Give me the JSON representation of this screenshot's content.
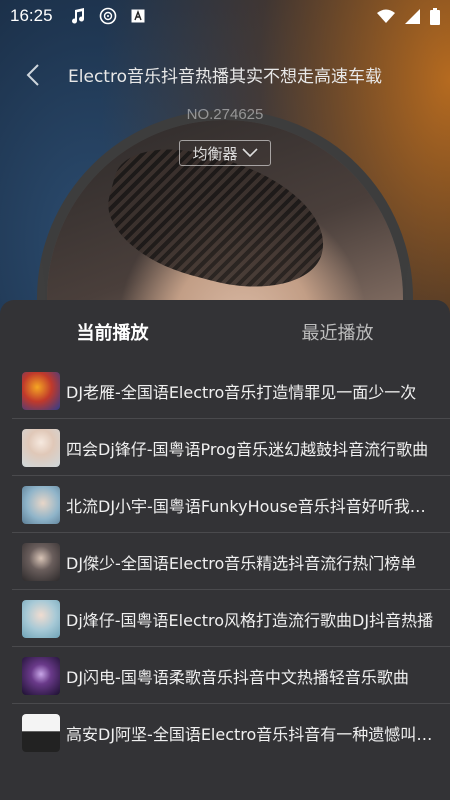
{
  "status_bar": {
    "time": "16:25",
    "left_icons": [
      "music-note-icon",
      "disc-icon",
      "font-a-icon"
    ],
    "right_icons": [
      "wifi-icon",
      "cellular-signal-icon",
      "battery-icon"
    ]
  },
  "player": {
    "title": "Electro音乐抖音热播其实不想走高速车载",
    "number": "NO.274625",
    "eq_label": "均衡器",
    "eq_icon": "chevron-down-icon",
    "back_icon": "back-arrow-icon"
  },
  "sheet": {
    "tabs": [
      {
        "label": "当前播放",
        "active": true
      },
      {
        "label": "最近播放",
        "active": false
      }
    ],
    "items": [
      {
        "title": "DJ老雁-全国语Electro音乐打造情罪见一面少一次",
        "thumb_color": "#c0392b"
      },
      {
        "title": "四会Dj锋仔-国粤语Prog音乐迷幻越鼓抖音流行歌曲",
        "thumb_color": "#e8d8cc"
      },
      {
        "title": "北流DJ小宇-国粤语FunkyHouse音乐抖音好听我的歌曲",
        "thumb_color": "#8fb4c9"
      },
      {
        "title": "DJ傑少-全国语Electro音乐精选抖音流行热门榜单",
        "thumb_color": "#4a4446"
      },
      {
        "title": "Dj烽仔-国粤语Electro风格打造流行歌曲DJ抖音热播",
        "thumb_color": "#a7c9d6"
      },
      {
        "title": "DJ闪电-国粤语柔歌音乐抖音中文热播轻音乐歌曲",
        "thumb_color": "#3a1f4a"
      },
      {
        "title": "高安DJ阿坚-全国语Electro音乐抖音有一种遗憾叫错过",
        "thumb_color": "#f2f2f2"
      }
    ]
  }
}
